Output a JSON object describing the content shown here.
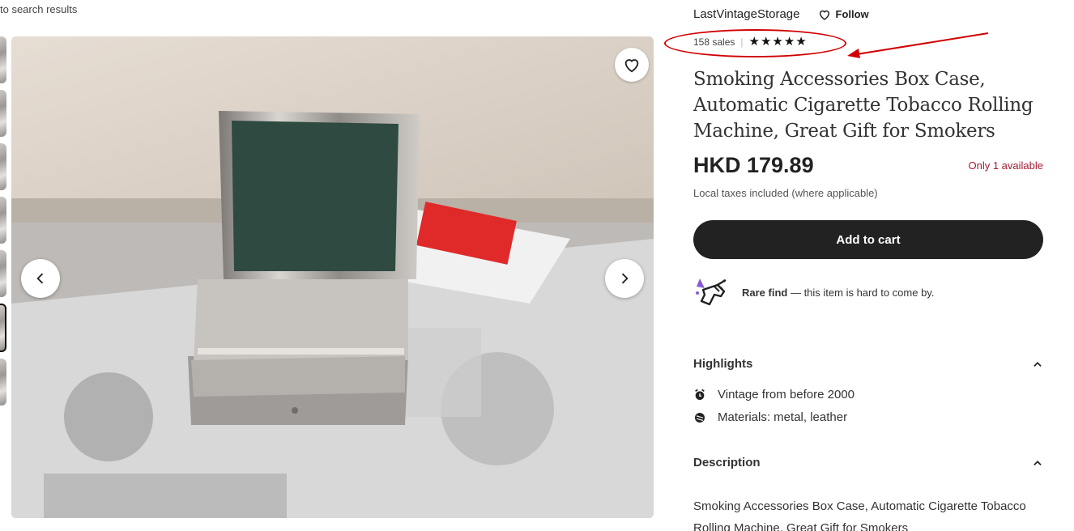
{
  "nav": {
    "back_text": "to search results"
  },
  "gallery": {
    "thumbnail_count": 7,
    "active_thumbnail_index": 5
  },
  "shop": {
    "name": "LastVintageStorage",
    "follow_label": "Follow"
  },
  "rating": {
    "sales_text": "158 sales",
    "stars": 5
  },
  "product": {
    "title": "Smoking Accessories Box Case, Automatic Cigarette Tobacco Rolling Machine, Great Gift for Smokers",
    "price": "HKD 179.89",
    "stock_text": "Only 1 available",
    "tax_text": "Local taxes included (where applicable)"
  },
  "cart": {
    "button_label": "Add to cart"
  },
  "rare_find": {
    "bold": "Rare find",
    "rest": " — this item is hard to come by."
  },
  "highlights": {
    "header": "Highlights",
    "items": [
      {
        "icon": "vintage-icon",
        "text": "Vintage from before 2000"
      },
      {
        "icon": "materials-icon",
        "text": "Materials: metal, leather"
      }
    ]
  },
  "description": {
    "header": "Description",
    "text": "Smoking Accessories Box Case, Automatic Cigarette Tobacco Rolling Machine, Great Gift for Smokers"
  },
  "colors": {
    "stock": "#a61a2e",
    "button": "#222222",
    "annotation": "#d10000"
  }
}
